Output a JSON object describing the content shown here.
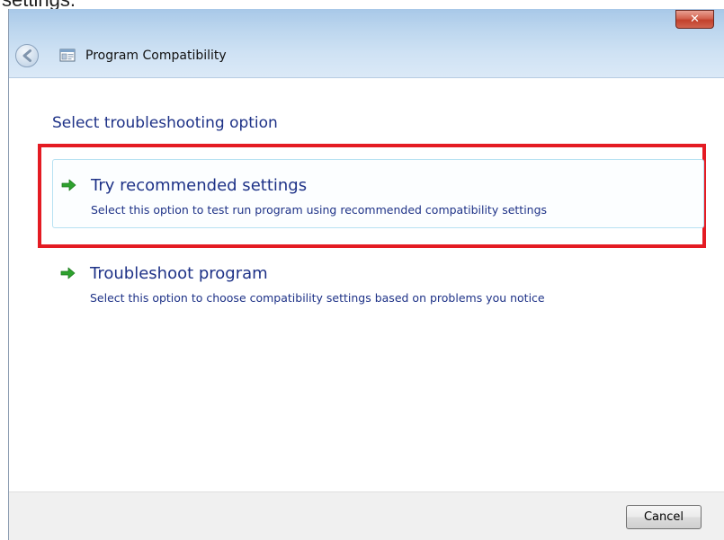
{
  "cropped_text": "settings.",
  "window": {
    "close_glyph": "✕",
    "title": "Program Compatibility"
  },
  "main": {
    "heading": "Select troubleshooting option",
    "options": [
      {
        "title": "Try recommended settings",
        "description": "Select this option to test run program using recommended compatibility settings",
        "highlighted": true
      },
      {
        "title": "Troubleshoot program",
        "description": "Select this option to choose compatibility settings based on problems you notice",
        "highlighted": false
      }
    ]
  },
  "footer": {
    "cancel_label": "Cancel"
  },
  "colors": {
    "heading_blue": "#1e3287",
    "highlight_red": "#e41b23",
    "arrow_green": "#2ea22e",
    "close_red": "#c2412c"
  },
  "icons": {
    "back": "back-arrow-icon",
    "program": "program-window-icon",
    "option_arrow": "green-arrow-icon",
    "close": "close-icon"
  }
}
